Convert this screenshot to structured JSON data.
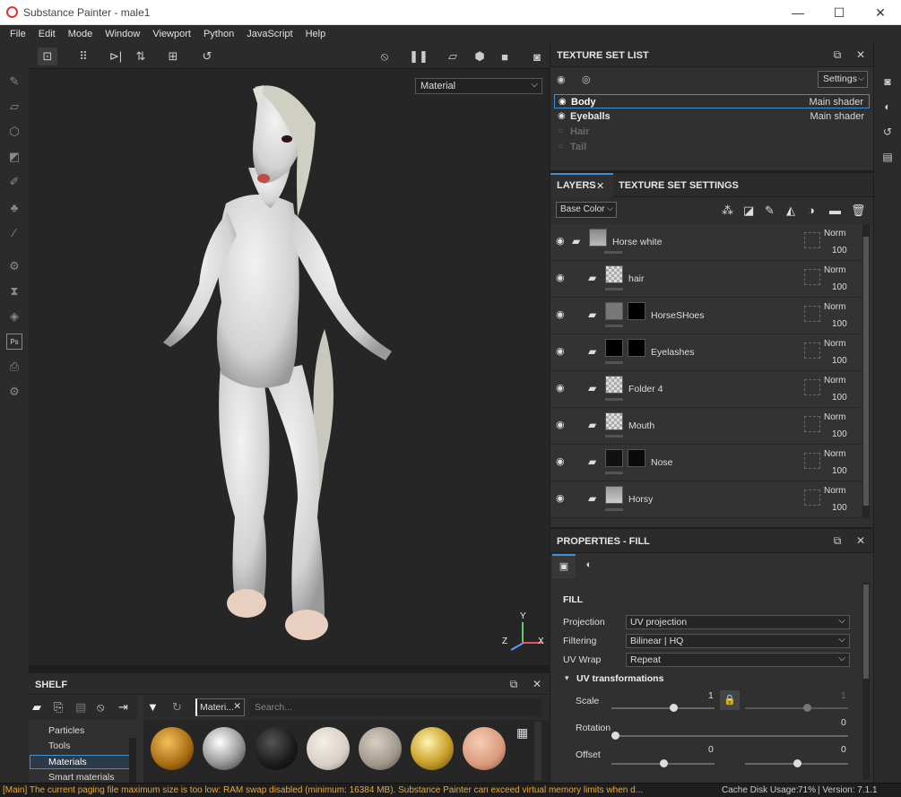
{
  "window": {
    "title": "Substance Painter - male1",
    "minimize": "—",
    "maximize": "☐",
    "close": "✕"
  },
  "menu": [
    "File",
    "Edit",
    "Mode",
    "Window",
    "Viewport",
    "Python",
    "JavaScript",
    "Help"
  ],
  "viewport": {
    "material_select": "Material",
    "gizmo": {
      "y": "Y",
      "z": "Z",
      "x": "X"
    }
  },
  "texture_set_list": {
    "title": "TEXTURE SET LIST",
    "settings": "Settings",
    "items": [
      {
        "name": "Body",
        "shader": "Main shader"
      },
      {
        "name": "Eyeballs",
        "shader": "Main shader"
      },
      {
        "name": "Hair",
        "shader": ""
      },
      {
        "name": "Tail",
        "shader": ""
      }
    ]
  },
  "layers": {
    "tab_layers": "LAYERS",
    "tab_tss": "TEXTURE SET SETTINGS",
    "channel": "Base Color",
    "rows": [
      {
        "name": "Horse white",
        "blend": "Norm",
        "opacity": "100"
      },
      {
        "name": "hair",
        "blend": "Norm",
        "opacity": "100"
      },
      {
        "name": "HorseSHoes",
        "blend": "Norm",
        "opacity": "100"
      },
      {
        "name": "Eyelashes",
        "blend": "Norm",
        "opacity": "100"
      },
      {
        "name": "Folder 4",
        "blend": "Norm",
        "opacity": "100"
      },
      {
        "name": "Mouth",
        "blend": "Norm",
        "opacity": "100"
      },
      {
        "name": "Nose",
        "blend": "Norm",
        "opacity": "100"
      },
      {
        "name": "Horsy",
        "blend": "Norm",
        "opacity": "100"
      }
    ]
  },
  "properties": {
    "title": "PROPERTIES - FILL",
    "section": "FILL",
    "projection_label": "Projection",
    "projection": "UV projection",
    "filtering_label": "Filtering",
    "filtering": "Bilinear | HQ",
    "uvwrap_label": "UV Wrap",
    "uvwrap": "Repeat",
    "uvt": "UV transformations",
    "scale_label": "Scale",
    "scale_value": "1",
    "scale_value2": "1",
    "rotation_label": "Rotation",
    "rotation_value": "0",
    "offset_label": "Offset",
    "offset_value": "0",
    "offset_value2": "0"
  },
  "shelf": {
    "title": "SHELF",
    "filter_tag": "Materi...",
    "search_placeholder": "Search...",
    "categories": [
      "Particles",
      "Tools",
      "Materials",
      "Smart materials"
    ]
  },
  "status": {
    "message": "[Main] The current paging file maximum size is too low: RAM swap disabled (minimum: 16384 MB). Substance Painter can exceed virtual memory limits when d...",
    "cache": "Cache Disk Usage:",
    "cache_value": "71%",
    "version": "| Version: 7.1.1"
  }
}
